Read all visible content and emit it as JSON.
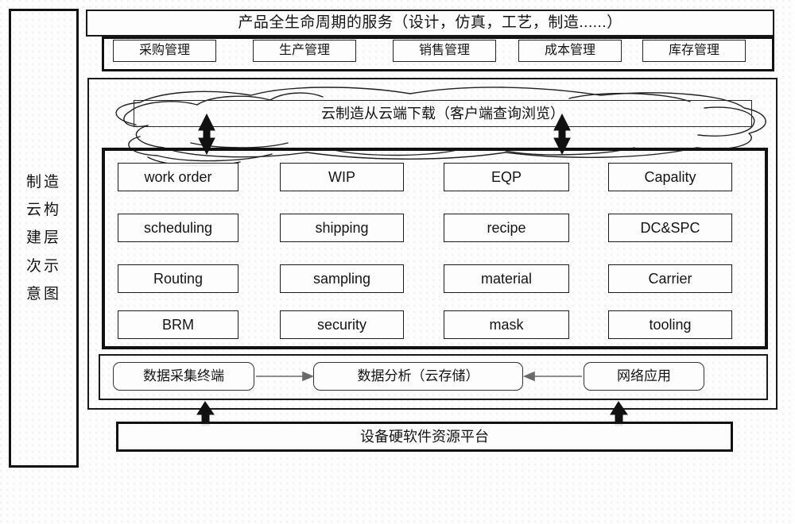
{
  "diagram": {
    "title": "制造云构建层次示意图",
    "sidebar": {
      "label": "制造云构建层次示意图"
    },
    "header": {
      "title": "产品全生命周期的服务（设计，仿真，工艺，制造......）",
      "management_buttons": [
        {
          "label": "采购管理"
        },
        {
          "label": "生产管理"
        },
        {
          "label": "销售管理"
        },
        {
          "label": "成本管理"
        },
        {
          "label": "库存管理"
        }
      ]
    },
    "cloud": {
      "caption": "云制造从云端下载（客户端查询浏览）",
      "shape": "hand-drawn-cloud"
    },
    "modules": {
      "rows": [
        [
          {
            "label": "work order"
          },
          {
            "label": "WIP"
          },
          {
            "label": "EQP"
          },
          {
            "label": "Capality"
          }
        ],
        [
          {
            "label": "scheduling"
          },
          {
            "label": "shipping"
          },
          {
            "label": "recipe"
          },
          {
            "label": "DC&SPC"
          }
        ],
        [
          {
            "label": "Routing"
          },
          {
            "label": "sampling"
          },
          {
            "label": "material"
          },
          {
            "label": "Carrier"
          }
        ],
        [
          {
            "label": "BRM"
          },
          {
            "label": "security"
          },
          {
            "label": "mask"
          },
          {
            "label": "tooling"
          }
        ]
      ]
    },
    "data_flow": {
      "acquisition": {
        "label": "数据采集终端"
      },
      "analysis": {
        "label": "数据分析（云存储）"
      },
      "network": {
        "label": "网络应用"
      }
    },
    "platform": {
      "label": "设备硬软件资源平台"
    },
    "colors": {
      "line": "#111111",
      "background": "#fdfdfd",
      "text": "#141414",
      "arrow_gray": "#6a6a6a"
    }
  }
}
